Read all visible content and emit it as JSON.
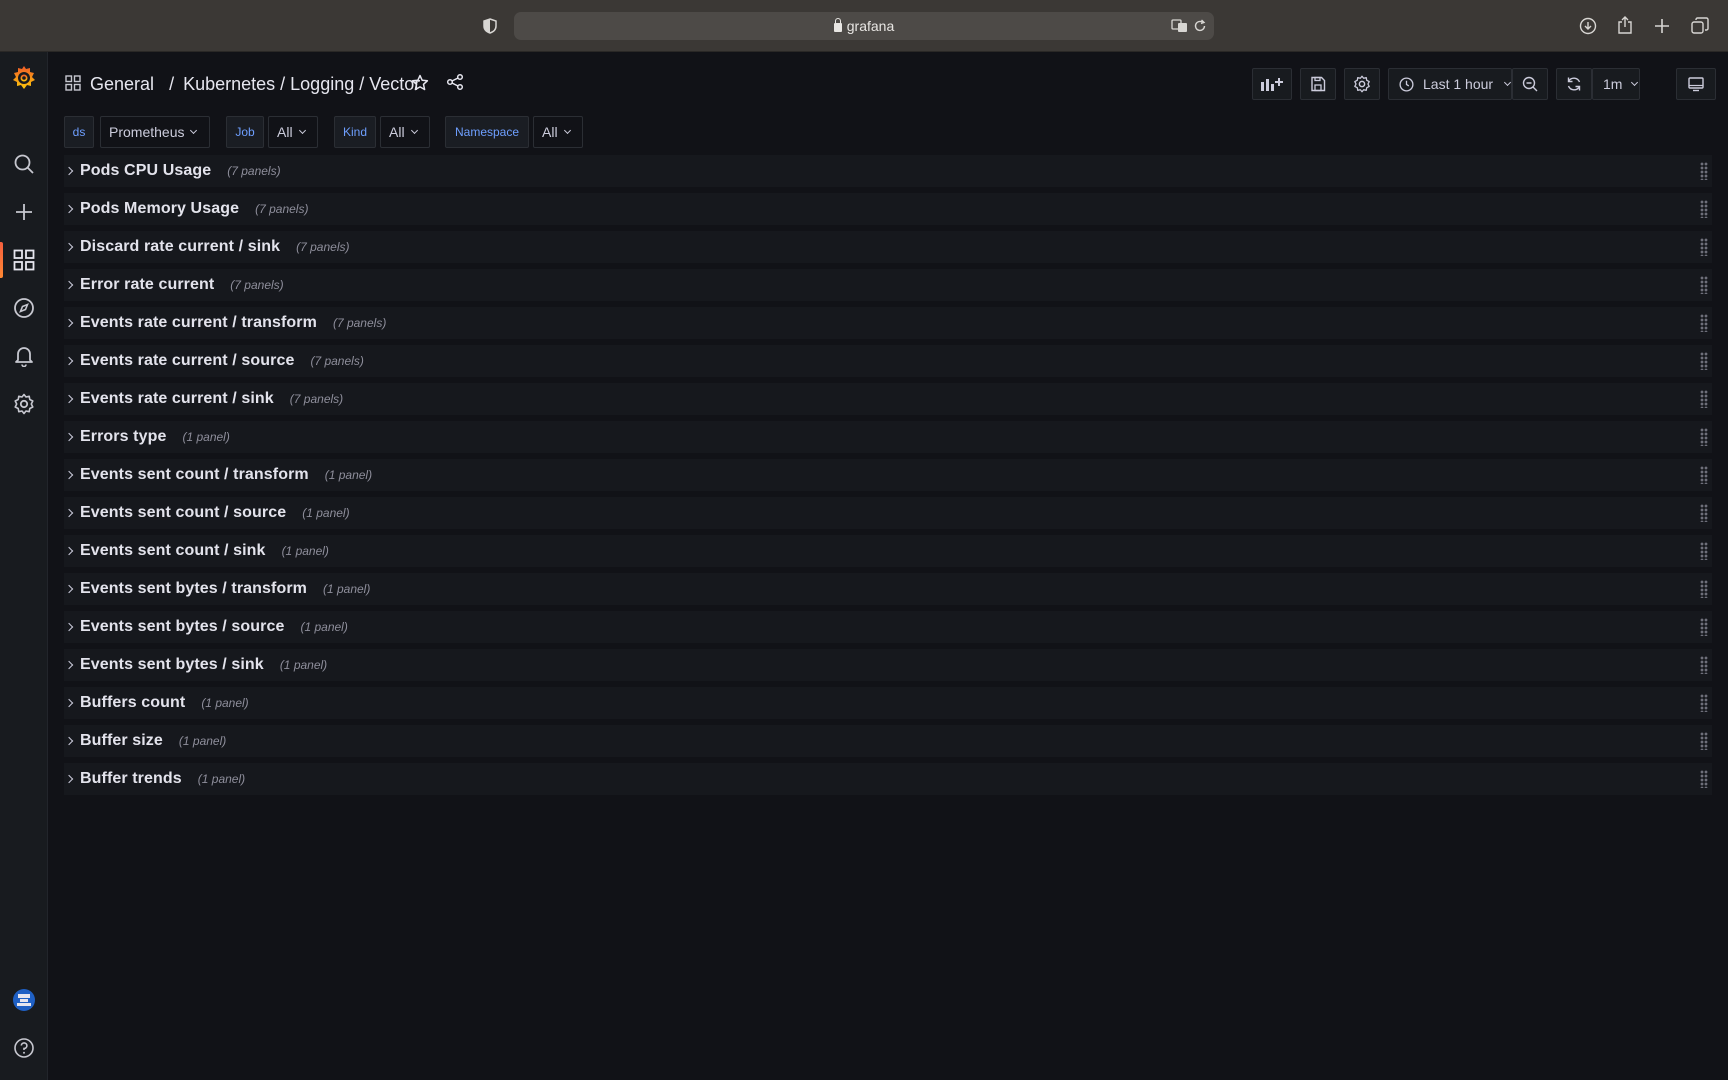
{
  "browser": {
    "url": "grafana"
  },
  "breadcrumb": {
    "folder": "General",
    "separator": "/",
    "title": "Kubernetes / Logging / Vector"
  },
  "toolbar": {
    "time_range": "Last 1 hour",
    "refresh_interval": "1m"
  },
  "variables": [
    {
      "label": "ds",
      "value": "Prometheus"
    },
    {
      "label": "Job",
      "value": "All"
    },
    {
      "label": "Kind",
      "value": "All"
    },
    {
      "label": "Namespace",
      "value": "All"
    }
  ],
  "rows": [
    {
      "title": "Pods CPU Usage",
      "count": "(7 panels)"
    },
    {
      "title": "Pods Memory Usage",
      "count": "(7 panels)"
    },
    {
      "title": "Discard rate current / sink",
      "count": "(7 panels)"
    },
    {
      "title": "Error rate current",
      "count": "(7 panels)"
    },
    {
      "title": "Events rate current / transform",
      "count": "(7 panels)"
    },
    {
      "title": "Events rate current / source",
      "count": "(7 panels)"
    },
    {
      "title": "Events rate current / sink",
      "count": "(7 panels)"
    },
    {
      "title": "Errors type",
      "count": "(1 panel)"
    },
    {
      "title": "Events sent count / transform",
      "count": "(1 panel)"
    },
    {
      "title": "Events sent count / source",
      "count": "(1 panel)"
    },
    {
      "title": "Events sent count / sink",
      "count": "(1 panel)"
    },
    {
      "title": "Events sent bytes / transform",
      "count": "(1 panel)"
    },
    {
      "title": "Events sent bytes / source",
      "count": "(1 panel)"
    },
    {
      "title": "Events sent bytes / sink",
      "count": "(1 panel)"
    },
    {
      "title": "Buffers count",
      "count": "(1 panel)"
    },
    {
      "title": "Buffer size",
      "count": "(1 panel)"
    },
    {
      "title": "Buffer trends",
      "count": "(1 panel)"
    }
  ],
  "icons": {
    "sidebar": [
      "grafana-logo-icon",
      "search-icon",
      "plus-icon",
      "dashboards-icon",
      "explore-icon",
      "bell-icon",
      "gear-icon",
      "user-avatar-icon",
      "help-icon"
    ],
    "accent": "#f55f3e",
    "link_blue": "#6e9fff"
  }
}
